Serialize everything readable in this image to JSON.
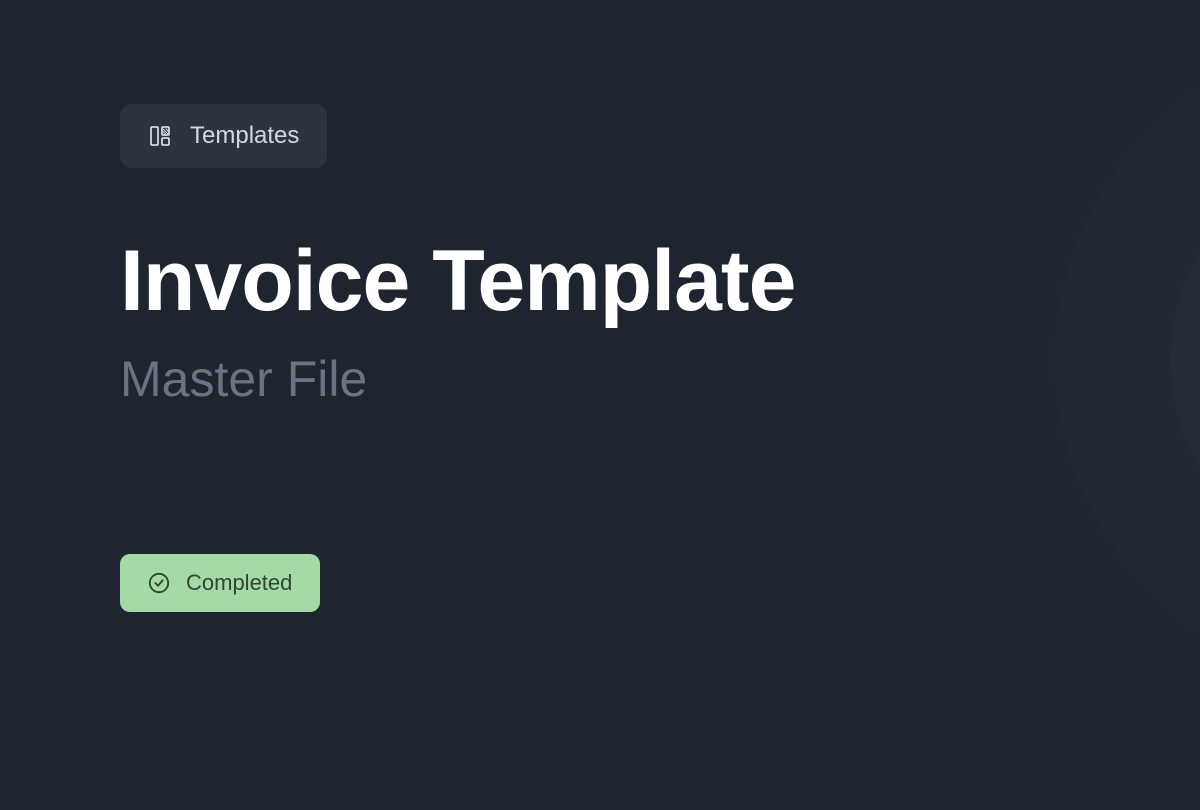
{
  "category": {
    "label": "Templates",
    "icon": "templates-icon"
  },
  "title": "Invoice Template",
  "subtitle": "Master File",
  "status": {
    "label": "Completed",
    "icon": "check-circle-icon"
  },
  "decoration": {
    "icon": "figma-icon"
  }
}
